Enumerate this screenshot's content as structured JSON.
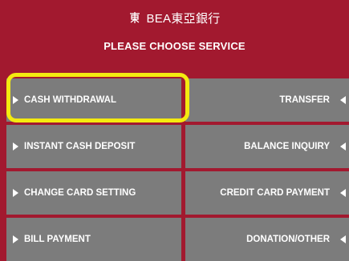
{
  "header": {
    "brand": "BEA東亞銀行",
    "title": "PLEASE CHOOSE SERVICE",
    "logo_icon": "bea-logo-icon"
  },
  "menu": {
    "left": [
      {
        "label": "CASH WITHDRAWAL",
        "selected": true
      },
      {
        "label": "INSTANT CASH DEPOSIT"
      },
      {
        "label": "CHANGE CARD SETTING"
      },
      {
        "label": "BILL PAYMENT"
      }
    ],
    "right": [
      {
        "label": "TRANSFER"
      },
      {
        "label": "BALANCE INQUIRY"
      },
      {
        "label": "CREDIT CARD PAYMENT"
      },
      {
        "label": "DONATION/OTHER"
      }
    ]
  },
  "colors": {
    "brand_red": "#a2192f",
    "button_gray": "#7c7c7c",
    "highlight_yellow": "#f4ea10"
  }
}
